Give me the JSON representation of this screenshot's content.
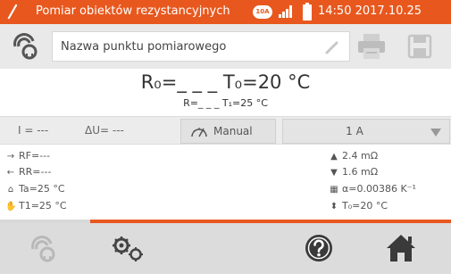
{
  "status_bar": {
    "title": "Pomiar obiektów rezystancyjnych",
    "current_badge": "10A",
    "time_date": "14:50 2017.10.25",
    "colors": {
      "accent": "#e8581e"
    }
  },
  "top_row": {
    "name_placeholder": "Nazwa punktu pomiarowego",
    "icons": [
      "resistance-probe-icon",
      "pencil-icon",
      "printer-icon",
      "save-icon"
    ]
  },
  "result": {
    "main": "R₀=_ _ _ T₀=20 °C",
    "sub": "R=_ _ _ T₁=25 °C"
  },
  "params": {
    "current": "I = ---",
    "voltage_drop": "ΔU= ---",
    "mode_label": "Manual",
    "current_range": "1 A"
  },
  "details": {
    "left": [
      {
        "icon": "arrow-right-icon",
        "text": "RF=---"
      },
      {
        "icon": "arrow-left-icon",
        "text": "RR=---"
      },
      {
        "icon": "ambient-temperature-icon",
        "text": "Ta=25 °C"
      },
      {
        "icon": "object-temperature-icon",
        "text": "T1=25 °C"
      }
    ],
    "right": [
      {
        "icon": "upper-limit-icon",
        "text": "2.4 mΩ"
      },
      {
        "icon": "lower-limit-icon",
        "text": "1.6 mΩ"
      },
      {
        "icon": "material-coefficient-icon",
        "text": "α=0.00386 K⁻¹"
      },
      {
        "icon": "reference-temperature-icon",
        "text": "T₀=20 °C"
      }
    ]
  },
  "bottom_nav": {
    "icons": [
      "resistance-probe-icon",
      "settings-gears-icon",
      "help-icon",
      "home-icon"
    ]
  }
}
